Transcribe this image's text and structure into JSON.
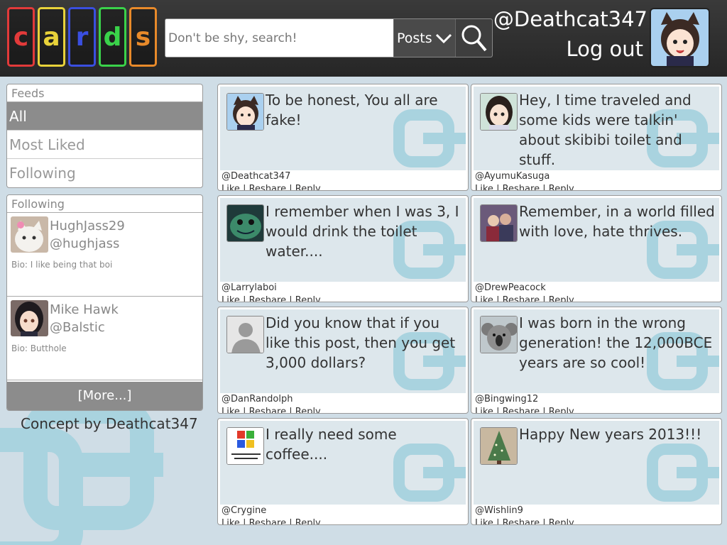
{
  "header": {
    "logo_letters": [
      "c",
      "a",
      "r",
      "d",
      "s"
    ],
    "logo_colors": [
      "#e23a3a",
      "#e8d23a",
      "#3a4fe0",
      "#3ad24a",
      "#e88a2a"
    ],
    "search_placeholder": "Don't be shy, search!",
    "search_scope": "Posts",
    "username": "@Deathcat347",
    "logout_label": "Log out"
  },
  "sidebar": {
    "feeds_title": "Feeds",
    "feeds": [
      {
        "label": "All",
        "active": true
      },
      {
        "label": "Most Liked",
        "active": false
      },
      {
        "label": "Following",
        "active": false
      }
    ],
    "following_title": "Following",
    "following": [
      {
        "name": "HughJass29",
        "handle": "@hughjass",
        "bio": "Bio: I like being that boi"
      },
      {
        "name": "Mike Hawk",
        "handle": "@Balstic",
        "bio": "Bio: Butthole"
      }
    ],
    "more_label": "[More...]",
    "concept": "Concept by Deathcat347"
  },
  "posts": [
    {
      "text": "To be honest, You all are fake!",
      "handle": "@Deathcat347"
    },
    {
      "text": "Hey, I time traveled and some kids were talkin' about skibibi toilet and stuff.",
      "handle": "@AyumuKasuga"
    },
    {
      "text": "I remember when I was 3, I would drink the toilet water....",
      "handle": "@Larrylaboi"
    },
    {
      "text": "Remember, in a world filled with love, hate thrives.",
      "handle": "@DrewPeacock"
    },
    {
      "text": "Did you know that if you like this post, then you get 3,000 dollars?",
      "handle": "@DanRandolph"
    },
    {
      "text": "I was born in the wrong generation! the 12,000BCE years are so cool!",
      "handle": "@Bingwing12"
    },
    {
      "text": "I really need some coffee....",
      "handle": "@Crygine"
    },
    {
      "text": "Happy New years 2013!!!",
      "handle": "@Wishlin9"
    }
  ],
  "actions": {
    "like": "Like",
    "reshare": "Reshare",
    "reply": "Reply",
    "separator": "|"
  },
  "avatar_icons": [
    "cat-ear-girl-icon",
    "anime-girl-icon",
    "green-creature-icon",
    "couple-photo-icon",
    "default-user-icon",
    "koala-icon",
    "windows-logo-icon",
    "christmas-tree-icon"
  ],
  "watermark_color": "#a9d3df"
}
